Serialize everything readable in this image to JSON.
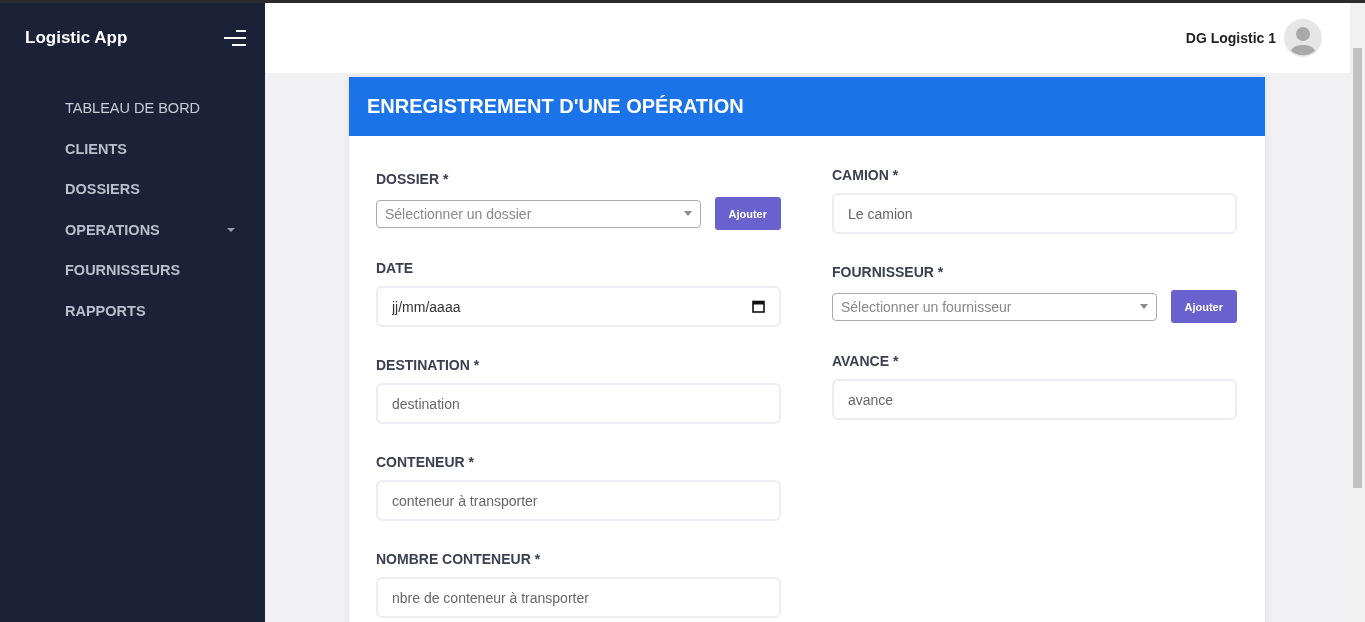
{
  "sidebar": {
    "brand": "Logistic App",
    "items": [
      {
        "label": "TABLEAU DE BORD",
        "kind": "link",
        "selected": true
      },
      {
        "label": "CLIENTS",
        "kind": "link",
        "selected": false
      },
      {
        "label": "DOSSIERS",
        "kind": "link",
        "selected": false
      },
      {
        "label": "OPERATIONS",
        "kind": "dropdown",
        "selected": false
      },
      {
        "label": "FOURNISSEURS",
        "kind": "link",
        "selected": false
      },
      {
        "label": "RAPPORTS",
        "kind": "link",
        "selected": false
      }
    ]
  },
  "topbar": {
    "user_name": "DG Logistic 1"
  },
  "form": {
    "title": "ENREGISTREMENT D'UNE OPÉRATION",
    "left_fields": [
      {
        "label": "DOSSIER *",
        "kind": "select",
        "placeholder": "Sélectionner un dossier",
        "button": "Ajouter"
      },
      {
        "label": "DATE",
        "kind": "date",
        "value": "jj/mm/aaaa"
      },
      {
        "label": "DESTINATION *",
        "kind": "text",
        "placeholder": "destination"
      },
      {
        "label": "CONTENEUR *",
        "kind": "text",
        "placeholder": "conteneur à transporter"
      },
      {
        "label": "NOMBRE CONTENEUR *",
        "kind": "text",
        "placeholder": "nbre de conteneur à transporter"
      }
    ],
    "right_fields": [
      {
        "label": "CAMION *",
        "kind": "text",
        "placeholder": "Le camion"
      },
      {
        "label": "FOURNISSEUR *",
        "kind": "select",
        "placeholder": "Sélectionner un fournisseur",
        "button": "Ajouter"
      },
      {
        "label": "AVANCE *",
        "kind": "text",
        "placeholder": "avance"
      }
    ]
  }
}
